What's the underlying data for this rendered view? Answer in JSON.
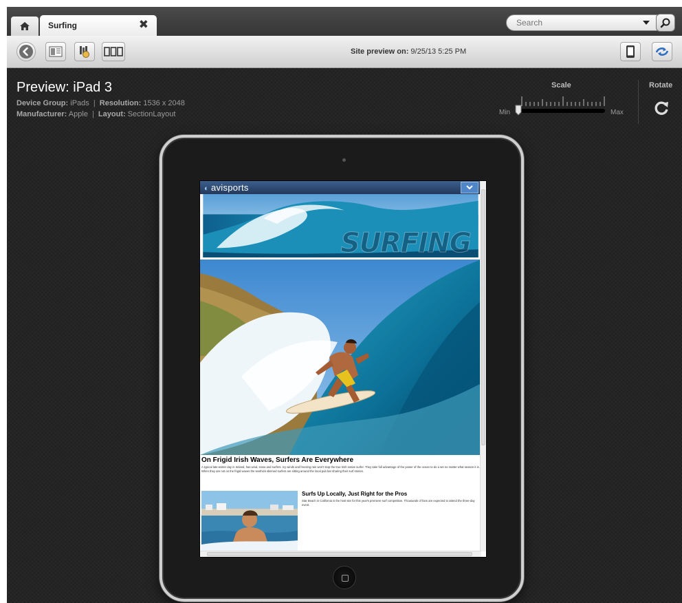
{
  "tabs": {
    "active_label": "Surfing",
    "close_glyph": "✖"
  },
  "search": {
    "placeholder": "Search"
  },
  "toolbar": {
    "preview_label": "Site preview on:",
    "preview_time": "9/25/13 5:25 PM"
  },
  "preview": {
    "title": "Preview: iPad 3",
    "device_group_label": "Device Group:",
    "device_group": "iPads",
    "resolution_label": "Resolution:",
    "resolution": "1536 x 2048",
    "manufacturer_label": "Manufacturer:",
    "manufacturer": "Apple",
    "layout_label": "Layout:",
    "layout": "SectionLayout",
    "separator": "|"
  },
  "controls": {
    "scale_label": "Scale",
    "rotate_label": "Rotate",
    "min_label": "Min",
    "max_label": "Max",
    "scale_value": 0.0
  },
  "site": {
    "logo": "avisports",
    "banner_text": "SURFING",
    "article1_title": "On Frigid Irish Waves, Surfers Are Everywhere",
    "article1_body": "A typical late-winter day in Ireland, has wind, snow and surfers. Icy winds and freezing rain won't stop the true Irish native surfer. They take full advantage of the power of the ocean to do a set no matter what season it is. When they are not on the frigid waves the seethick skinned surfers are sitting around the local pub bar sharing their surf stories.",
    "article2_title": "Surfs Up Locally, Just Right for the Pros",
    "article2_body": "Star Beach in California is the host site for this year's premiere surf competition. Thousands of fans are expected to attend the three-day event."
  },
  "icons": {
    "home": "home-icon",
    "search": "search-icon",
    "back": "back-icon",
    "layout": "layout-icon",
    "ribbon": "ribbon-icon",
    "multi_device": "multi-device-icon",
    "device": "device-icon",
    "sync": "sync-icon",
    "rotate": "rotate-icon"
  },
  "colors": {
    "background": "#242424",
    "accent": "#2f6fc0",
    "site_header": "#2a4670"
  }
}
